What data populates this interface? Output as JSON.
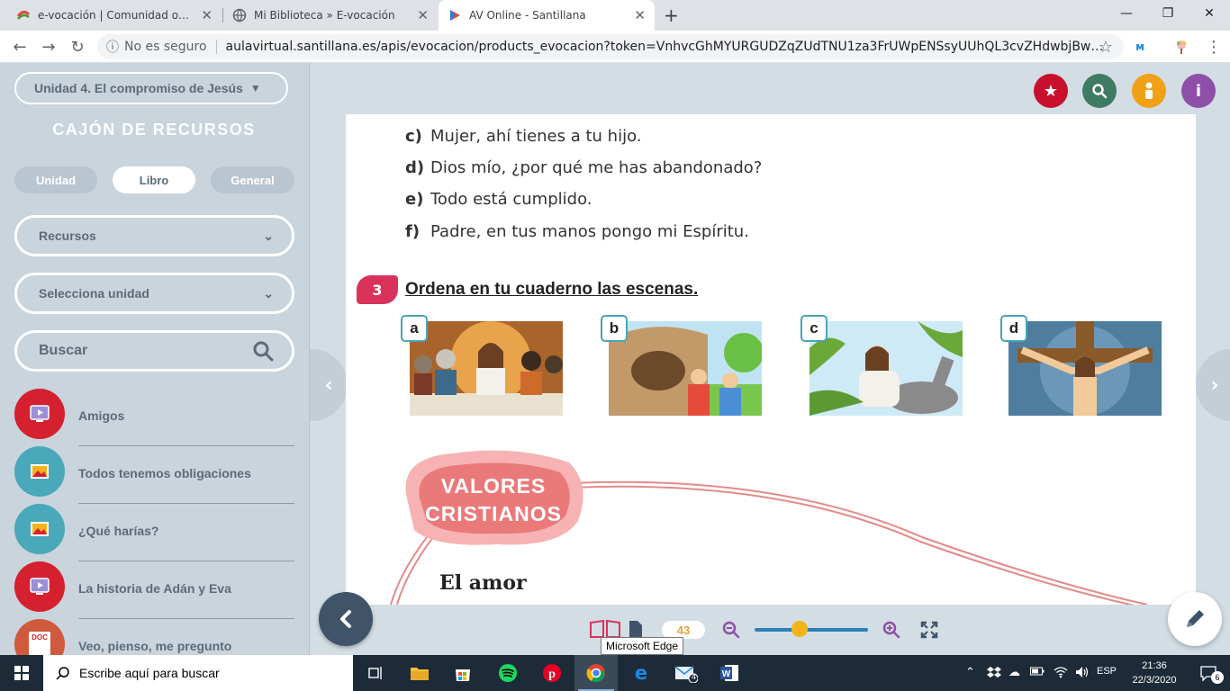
{
  "browser": {
    "tabs": [
      {
        "title": "e-vocación | Comunidad online d"
      },
      {
        "title": "Mi Biblioteca » E-vocación"
      },
      {
        "title": "AV Online - Santillana"
      }
    ],
    "new_tab": "+",
    "security_label": "No es seguro",
    "url": "aulavirtual.santillana.es/apis/evocacion/products_evocacion?token=VnhvcGhMYURGUDZqZUdTNU1za3FrUWpENSsyUUhQL3cvZHdwbjBwWHVNdmtTTWF..."
  },
  "sidebar": {
    "unit_select": "Unidad 4. El compromiso de Jesús",
    "title": "CAJÓN DE RECURSOS",
    "tabs": [
      {
        "label": "Unidad"
      },
      {
        "label": "Libro"
      },
      {
        "label": "General"
      }
    ],
    "resources_select": "Recursos",
    "unit_filter": "Selecciona unidad",
    "search_placeholder": "Buscar",
    "items": [
      {
        "label": "Amigos"
      },
      {
        "label": "Todos tenemos obligaciones"
      },
      {
        "label": "¿Qué harías?"
      },
      {
        "label": "La historia de Adán y Eva"
      },
      {
        "label": "Veo, pienso, me pregunto"
      }
    ],
    "doc_badge": "DOC"
  },
  "book": {
    "lines": [
      {
        "letter": "c)",
        "text": "Mujer, ahí tienes a tu hijo."
      },
      {
        "letter": "d)",
        "text": "Dios mío, ¿por qué me has abandonado?"
      },
      {
        "letter": "e)",
        "text": "Todo está cumplido."
      },
      {
        "letter": "f)",
        "text": "Padre, en tus manos pongo mi Espíritu."
      }
    ],
    "activity_number": "3",
    "activity_text": "Ordena en tu cuaderno las escenas.",
    "scenes": [
      "a",
      "b",
      "c",
      "d"
    ],
    "section_title_line1": "VALORES",
    "section_title_line2": "CRISTIANOS",
    "subsection": "El amor"
  },
  "viewer": {
    "page_number": "43",
    "zoom_fraction": 0.4,
    "tooltip": "Microsoft Edge"
  },
  "taskbar": {
    "search_placeholder": "Escribe aquí para buscar",
    "language": "ESP",
    "time": "21:36",
    "date": "22/3/2020",
    "notifications": "6",
    "mail_count": "4"
  },
  "colors": {
    "accent_red": "#d9335c",
    "btn_red": "#c8102e",
    "btn_green": "#3f7a63",
    "btn_orange": "#f0a117",
    "btn_purple": "#8e4fa8"
  }
}
